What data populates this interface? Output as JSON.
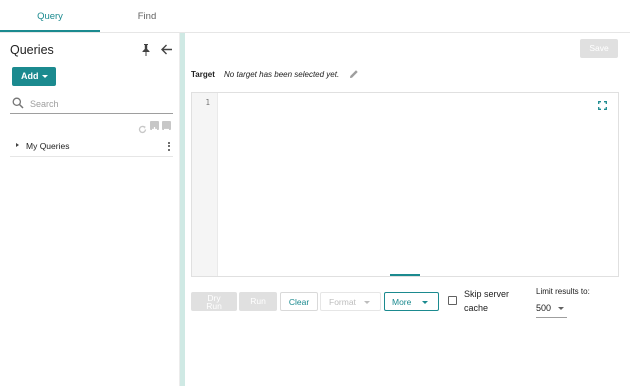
{
  "tabs": [
    {
      "label": "Query",
      "active": true
    },
    {
      "label": "Find",
      "active": false
    }
  ],
  "sidebar": {
    "title": "Queries",
    "pin_icon": "pin-icon",
    "back_icon": "arrow-left-icon",
    "add_label": "Add",
    "search": {
      "placeholder": "Search",
      "value": ""
    },
    "tools": [
      "refresh-icon",
      "plus-icon",
      "minus-icon"
    ],
    "tree": [
      {
        "label": "My Queries",
        "expanded": false
      }
    ]
  },
  "toolbar": {
    "save_label": "Save"
  },
  "target": {
    "label": "Target",
    "value": "No target has been selected yet."
  },
  "editor": {
    "line_numbers": [
      "1"
    ],
    "content": ""
  },
  "actions": {
    "dry_run_label": "Dry\nRun",
    "run_label": "Run",
    "clear_label": "Clear",
    "format_label": "Format",
    "more_label": "More"
  },
  "options": {
    "skip_cache_label": "Skip server cache",
    "skip_cache_checked": false,
    "limit_label": "Limit results to:",
    "limit_value": "500"
  },
  "colors": {
    "accent": "#1b8a8f",
    "divider": "#cfe9e4",
    "disabled": "#e0e0e0"
  }
}
